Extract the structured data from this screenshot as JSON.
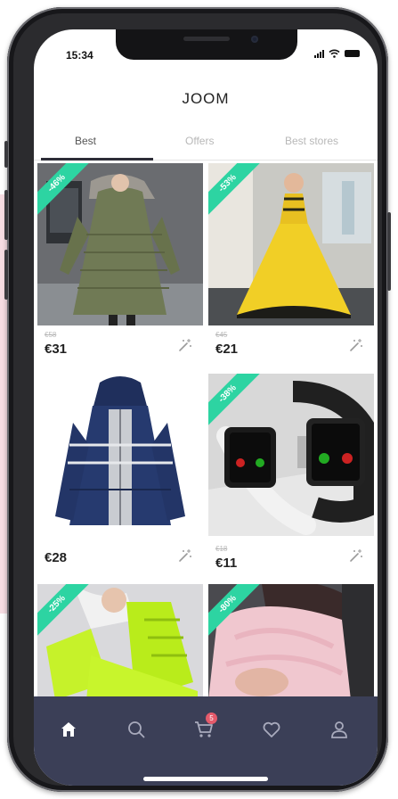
{
  "status_bar": {
    "time": "15:34"
  },
  "app": {
    "title": "JOOM"
  },
  "tabs": [
    {
      "label": "Best",
      "active": true
    },
    {
      "label": "Offers",
      "active": false
    },
    {
      "label": "Best stores",
      "active": false
    }
  ],
  "products": [
    {
      "badge": "-46%",
      "old_price": "€58",
      "price": "€31",
      "image": "green winter parka coat"
    },
    {
      "badge": "-53%",
      "old_price": "€45",
      "price": "€21",
      "image": "yellow ball gown dress"
    },
    {
      "badge": "",
      "old_price": "",
      "price": "€28",
      "image": "navy hooded puffer jacket"
    },
    {
      "badge": "-38%",
      "old_price": "€18",
      "price": "€11",
      "image": "smart watches"
    },
    {
      "badge": "-25%",
      "old_price": "",
      "price": "",
      "image": "neon green sneakers"
    },
    {
      "badge": "-80%",
      "old_price": "",
      "price": "",
      "image": "pink fur coat"
    }
  ],
  "bottom_nav": {
    "items": [
      {
        "icon": "home-icon",
        "active": true
      },
      {
        "icon": "search-icon",
        "active": false
      },
      {
        "icon": "cart-icon",
        "active": false,
        "badge": "5"
      },
      {
        "icon": "heart-icon",
        "active": false
      },
      {
        "icon": "profile-icon",
        "active": false
      }
    ]
  },
  "colors": {
    "accent_badge": "#2dd4a2",
    "nav_background": "#3b3f57",
    "cart_badge": "#e45a6b"
  }
}
